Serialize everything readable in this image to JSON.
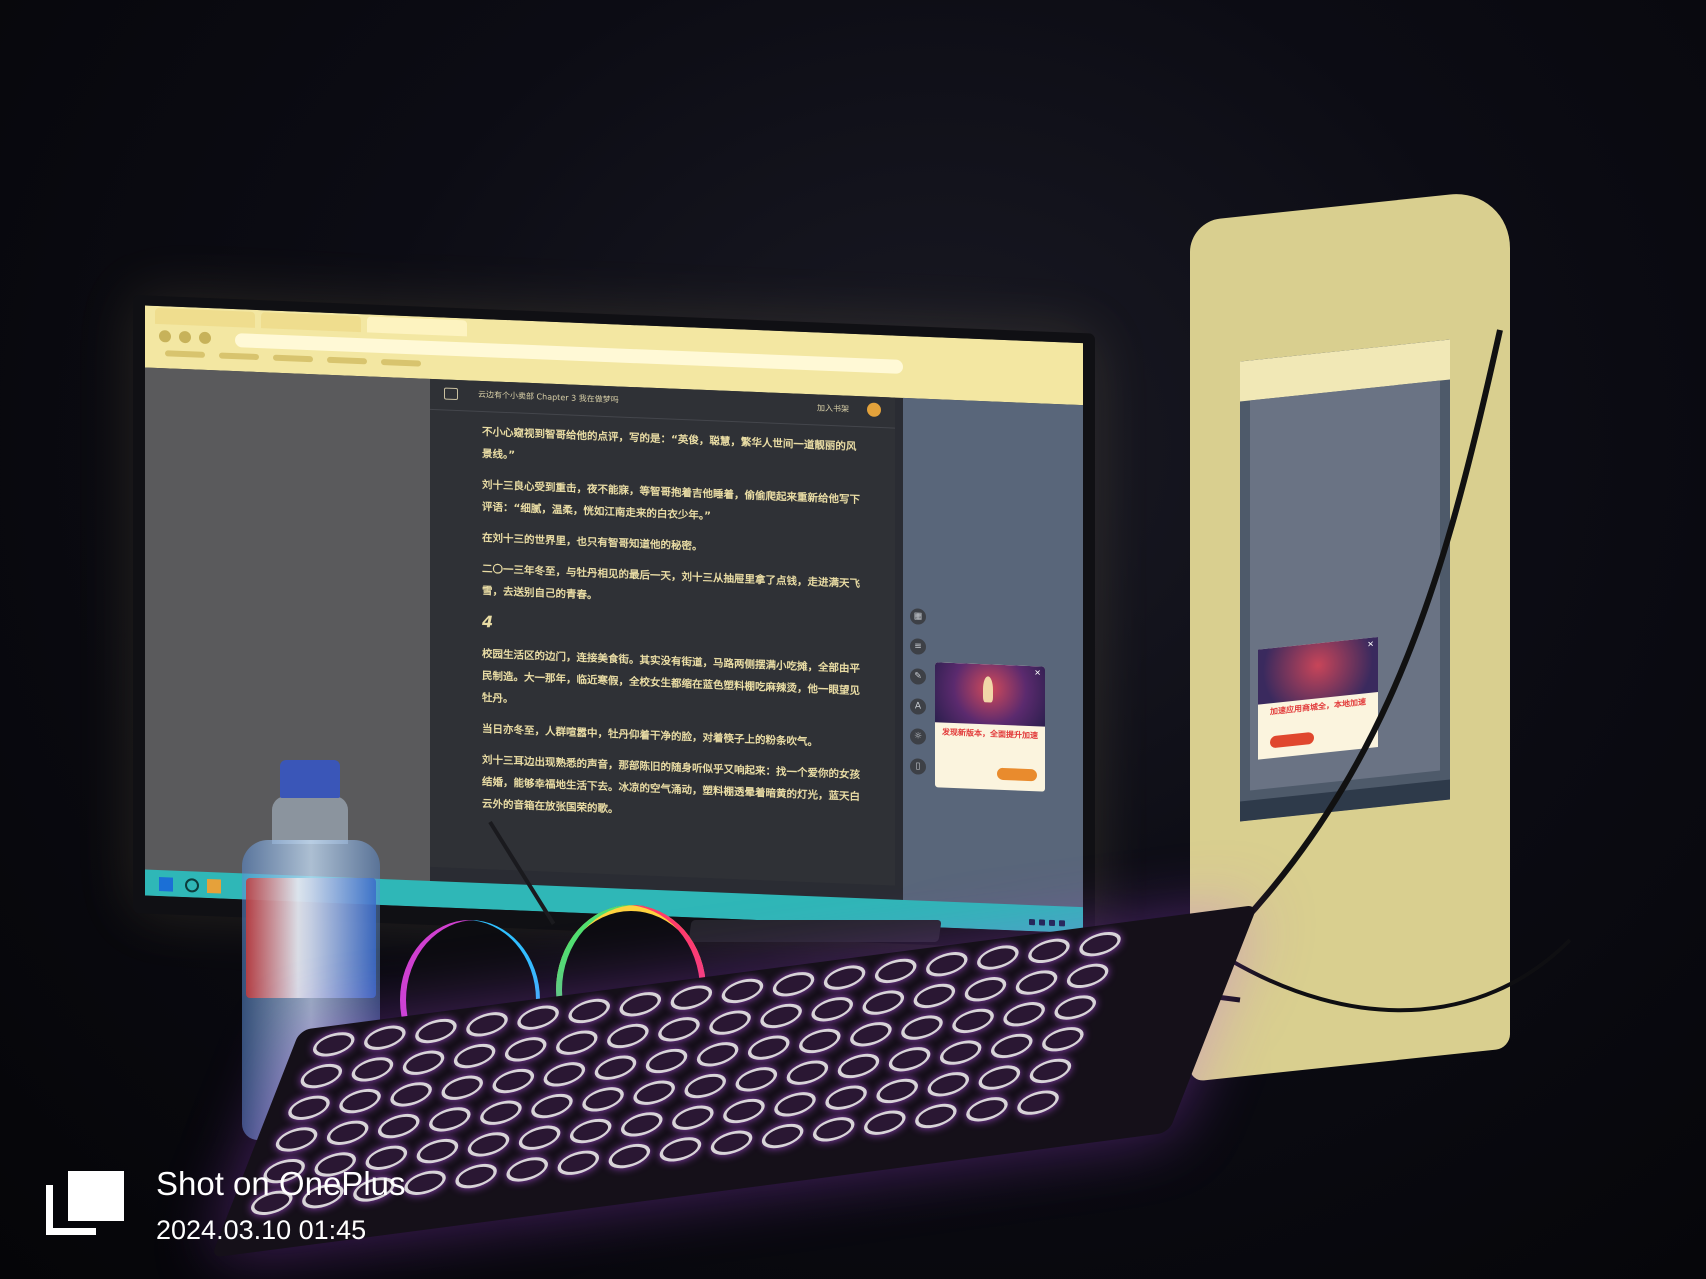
{
  "reader": {
    "title": "云边有个小卖部 Chapter 3 我在做梦吗",
    "shelf_label": "加入书架",
    "paragraphs": [
      "不小心窥视到智哥给他的点评，写的是：“英俊，聪慧，繁华人世间一道靓丽的风景线。”",
      "刘十三良心受到重击，夜不能寐，等智哥抱着吉他睡着，偷偷爬起来重新给他写下评语：“细腻，温柔，恍如江南走来的白衣少年。”",
      "在刘十三的世界里，也只有智哥知道他的秘密。",
      "二〇一三年冬至，与牡丹相见的最后一天，刘十三从抽屉里拿了点钱，走进满天飞雪，去送别自己的青春。"
    ],
    "chapter_number": "4",
    "paragraphs_2": [
      "校园生活区的边门，连接美食街。其实没有街道，马路两侧摆满小吃摊，全部由平民制造。大一那年，临近寒假，全校女生都缩在蓝色塑料棚吃麻辣烫，他一眼望见牡丹。",
      "当日亦冬至，人群喧嚣中，牡丹仰着干净的脸，对着筷子上的粉条吹气。",
      "刘十三耳边出现熟悉的声音，那部陈旧的随身听似乎又响起来：找一个爱你的女孩结婚，能够幸福地生活下去。冰凉的空气涌动，塑料棚透晕着暗黄的灯光，蓝天白云外的音箱在放张国荣的歌。"
    ]
  },
  "ads": {
    "main_headline": "发现新版本，全面提升加速",
    "secondary_headline": "加速应用商城全，本地加速"
  },
  "watermark": {
    "title": "Shot on OnePlus",
    "datetime": "2024.03.10 01:45"
  },
  "colors": {
    "browser_chrome": "#f3e7a2",
    "reader_bg": "#2f3136",
    "reader_text": "#e9dca4",
    "taskbar": "#2fb7b7",
    "keyboard_glow": "#c85aff"
  },
  "icons": [
    "menu-icon",
    "avatar-icon",
    "grid-icon",
    "list-icon",
    "pen-icon",
    "font-icon",
    "brightness-icon",
    "phone-icon",
    "windows-start-icon",
    "search-icon",
    "oneplus-logo-icon"
  ]
}
